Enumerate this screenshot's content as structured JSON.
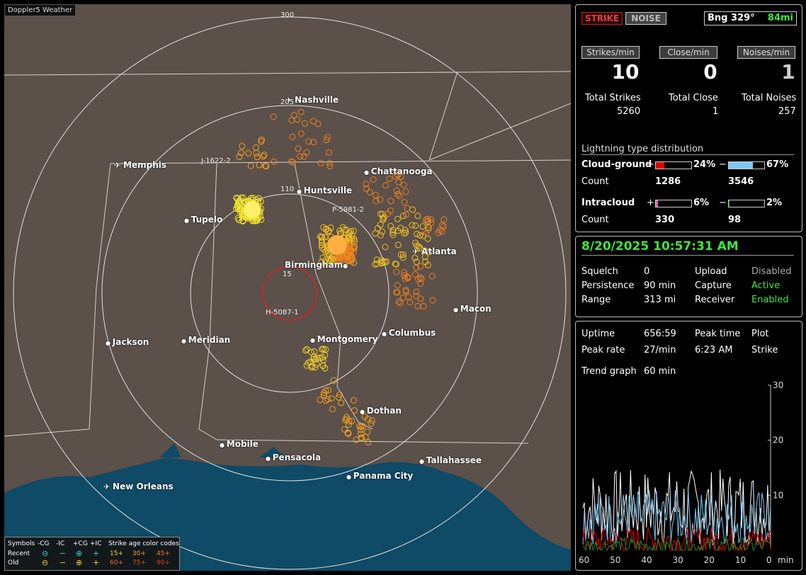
{
  "map": {
    "brand": "Doppler5 Weather",
    "range_labels": [
      "300",
      "205",
      "110",
      "15"
    ],
    "cities": [
      {
        "name": "Nashville",
        "airport": true
      },
      {
        "name": "Memphis",
        "airport": true
      },
      {
        "name": "Chattanooga",
        "airport": false
      },
      {
        "name": "Huntsville",
        "airport": false
      },
      {
        "name": "Tupelo",
        "airport": false
      },
      {
        "name": "Atlanta",
        "airport": true
      },
      {
        "name": "Birmingham",
        "airport": false
      },
      {
        "name": "Macon",
        "airport": false
      },
      {
        "name": "Columbus",
        "airport": false
      },
      {
        "name": "Montgomery",
        "airport": false
      },
      {
        "name": "Jackson",
        "airport": false
      },
      {
        "name": "Meridian",
        "airport": false
      },
      {
        "name": "Dothan",
        "airport": false
      },
      {
        "name": "Mobile",
        "airport": false
      },
      {
        "name": "Pensacola",
        "airport": false
      },
      {
        "name": "Tallahassee",
        "airport": false
      },
      {
        "name": "Panama City",
        "airport": false
      },
      {
        "name": "New Orleans",
        "airport": true
      }
    ],
    "storm_ids": [
      "J-1622-2",
      "P-5981-2",
      "H-5087-1"
    ]
  },
  "legend": {
    "symbols_label": "Symbols",
    "headers": [
      "-CG",
      "-IC",
      "+CG",
      "+IC"
    ],
    "age_title": "Strike age color codes",
    "recent_label": "Recent",
    "old_label": "Old",
    "recent_ages": [
      "15+",
      "30+",
      "45+"
    ],
    "old_ages": [
      "60+",
      "75+",
      "90+"
    ]
  },
  "status": {
    "strike_label": "STRIKE",
    "noise_label": "NOISE",
    "bearing": "Bng 329°",
    "distance": "84mi"
  },
  "rates": {
    "strikes_label": "Strikes/min",
    "close_label": "Close/min",
    "noises_label": "Noises/min",
    "strikes_value": "10",
    "close_value": "0",
    "noises_value": "1",
    "total_strikes_label": "Total Strikes",
    "total_close_label": "Total Close",
    "total_noises_label": "Total Noises",
    "total_strikes": "5260",
    "total_close": "1",
    "total_noises": "257"
  },
  "distribution": {
    "title": "Lightning type distribution",
    "cg_label": "Cloud-ground",
    "ic_label": "Intracloud",
    "count_label": "Count",
    "plus": "+",
    "minus": "−",
    "cg_pos_pct": "24%",
    "cg_neg_pct": "67%",
    "cg_pos_count": "1286",
    "cg_neg_count": "3546",
    "ic_pos_pct": "6%",
    "ic_neg_pct": "2%",
    "ic_pos_count": "330",
    "ic_neg_count": "98",
    "cg_pos_fraction": 0.24,
    "cg_neg_fraction": 0.67,
    "ic_pos_fraction": 0.06,
    "ic_neg_fraction": 0.02
  },
  "settings": {
    "datetime": "8/20/2025 10:57:31 AM",
    "squelch_label": "Squelch",
    "squelch": "0",
    "persistence_label": "Persistence",
    "persistence": "90 min",
    "range_label": "Range",
    "range": "313 mi",
    "upload_label": "Upload",
    "upload": "Disabled",
    "capture_label": "Capture",
    "capture": "Active",
    "receiver_label": "Receiver",
    "receiver": "Enabled"
  },
  "stats": {
    "uptime_label": "Uptime",
    "uptime": "656:59",
    "peak_time_label": "Peak time",
    "plot_label": "Plot",
    "peak_rate_label": "Peak rate",
    "peak_rate": "27/min",
    "peak_time": "6:23 AM",
    "plot": "Strike",
    "trend_label": "Trend graph",
    "trend_window": "60 min"
  },
  "chart_data": {
    "type": "line",
    "x_ticks": [
      "60",
      "50",
      "40",
      "30",
      "20",
      "10",
      "0"
    ],
    "x_unit": "min",
    "y_ticks": [
      "30",
      "20",
      "10"
    ],
    "ylim": [
      0,
      30
    ],
    "xlim": [
      60,
      0
    ]
  },
  "colors": {
    "accent_green": "#3ee83e",
    "cg_pos": "#e00000",
    "cg_neg": "#7ec8f0",
    "ic_pos": "#e060a0",
    "ic_neg": "#2a8a2a",
    "strike_box": "#c02020"
  }
}
